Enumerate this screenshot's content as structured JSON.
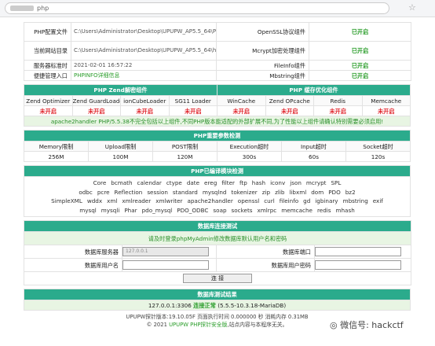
{
  "browser": {
    "url_tail": "php"
  },
  "info": [
    {
      "l1": "PHP配置文件",
      "v1": "C:\\Users\\Administrator\\Desktop\\UPUPW_AP5.5_64\\PHP5\\php.ini",
      "l2": "OpenSSL协议组件",
      "v2": "已开启"
    },
    {
      "l1": "当前网站目录",
      "v1": "C:\\Users\\Administrator\\Desktop\\UPUPW_AP5.5_64\\htdocs",
      "l2": "Mcrypt加密处理组件",
      "v2": "已开启"
    },
    {
      "l1": "服务器标准时",
      "v1": "2021-02-01 16:57:22",
      "l2": "FileInfo组件",
      "v2": "已开启"
    },
    {
      "l1": "便捷管理入口",
      "v1": "PHPINFO详细信息",
      "l2": "Mbstring组件",
      "v2": "已开启"
    }
  ],
  "zend": {
    "title": "PHP Zend解密组件",
    "cols": [
      "Zend Optimizer",
      "Zend GuardLoader",
      "ionCubeLoader",
      "SG11 Loader"
    ],
    "vals": [
      "未开启",
      "未开启",
      "未开启",
      "未开启"
    ]
  },
  "cache": {
    "title": "PHP 缓存优化组件",
    "cols": [
      "WinCache",
      "Zend OPcache",
      "Redis",
      "Memcache"
    ],
    "vals": [
      "未开启",
      "未开启",
      "未开启",
      "未开启"
    ]
  },
  "warning": "apache2handler PHP/5.5.38不完全包括以上组件,不同PHP版本能适配的外部扩展不同,为了性能以上组件请确认特别需要必须启用!",
  "params": {
    "title": "PHP重要参数检测",
    "cols": [
      "Memory限制",
      "Upload限制",
      "POST限制",
      "Execution超时",
      "Input超时",
      "Socket超时"
    ],
    "vals": [
      "256M",
      "100M",
      "120M",
      "300s",
      "60s",
      "120s"
    ]
  },
  "modules": {
    "title": "PHP已编译模块检测",
    "lines": [
      [
        "Core",
        "bcmath",
        "calendar",
        "ctype",
        "date",
        "ereg",
        "filter",
        "ftp",
        "hash",
        "iconv",
        "json",
        "mcrypt",
        "SPL"
      ],
      [
        "odbc",
        "pcre",
        "Reflection",
        "session",
        "standard",
        "mysqlnd",
        "tokenizer",
        "zip",
        "zlib",
        "libxml",
        "dom",
        "PDO",
        "bz2"
      ],
      [
        "SimpleXML",
        "wddx",
        "xml",
        "xmlreader",
        "xmlwriter",
        "apache2handler",
        "openssl",
        "curl",
        "fileinfo",
        "gd",
        "igbinary",
        "mbstring",
        "exif"
      ],
      [
        "mysql",
        "mysqli",
        "Phar",
        "pdo_mysql",
        "PDO_ODBC",
        "soap",
        "sockets",
        "xmlrpc",
        "memcache",
        "redis",
        "mhash"
      ]
    ]
  },
  "dbtest": {
    "title": "数据库连接测试",
    "notice": "请及时登录phpMyAdmin修改数据库默认用户名和密码",
    "server_label": "数据库服务器",
    "server_value": "127.0.0.1",
    "port_label": "数据库端口",
    "user_label": "数据库用户名",
    "pass_label": "数据库用户密码",
    "button": "连 接"
  },
  "result": {
    "title": "数据库测试结果",
    "host": "127.0.0.1:3306",
    "status": "连接正常",
    "version": "(5.5.5-10.3.18-MariaDB)"
  },
  "footer": {
    "line1": "UPUPW探针版本:19.10.05F 页面执行时间 0.000000 秒 消耗内存 0.31MB",
    "copy": "© 2021",
    "brand": "UPUPW PHP探针安全版",
    "tail": ",站点内容与本程序无关。"
  },
  "watermark": "微信号: hackctf",
  "colors": {
    "header": "#2bab8c",
    "on": "#2a9d2a",
    "off": "#e0232a"
  }
}
